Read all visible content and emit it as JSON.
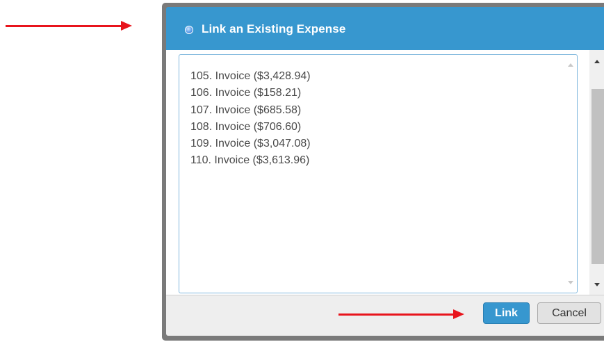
{
  "dialog": {
    "title": "Link an Existing Expense",
    "title_icon": "radio-dot-icon"
  },
  "expense_list": {
    "items": [
      "105. Invoice ($3,428.94)",
      "106. Invoice ($158.21)",
      "107. Invoice ($685.58)",
      "108. Invoice ($706.60)",
      "109. Invoice ($3,047.08)",
      "110. Invoice ($3,613.96)"
    ]
  },
  "buttons": {
    "link_label": "Link",
    "cancel_label": "Cancel"
  },
  "colors": {
    "title_bar": "#3797cf",
    "primary_button": "#3797cf",
    "annotation_arrow": "#e8141c",
    "list_text": "#4a4a4a"
  }
}
